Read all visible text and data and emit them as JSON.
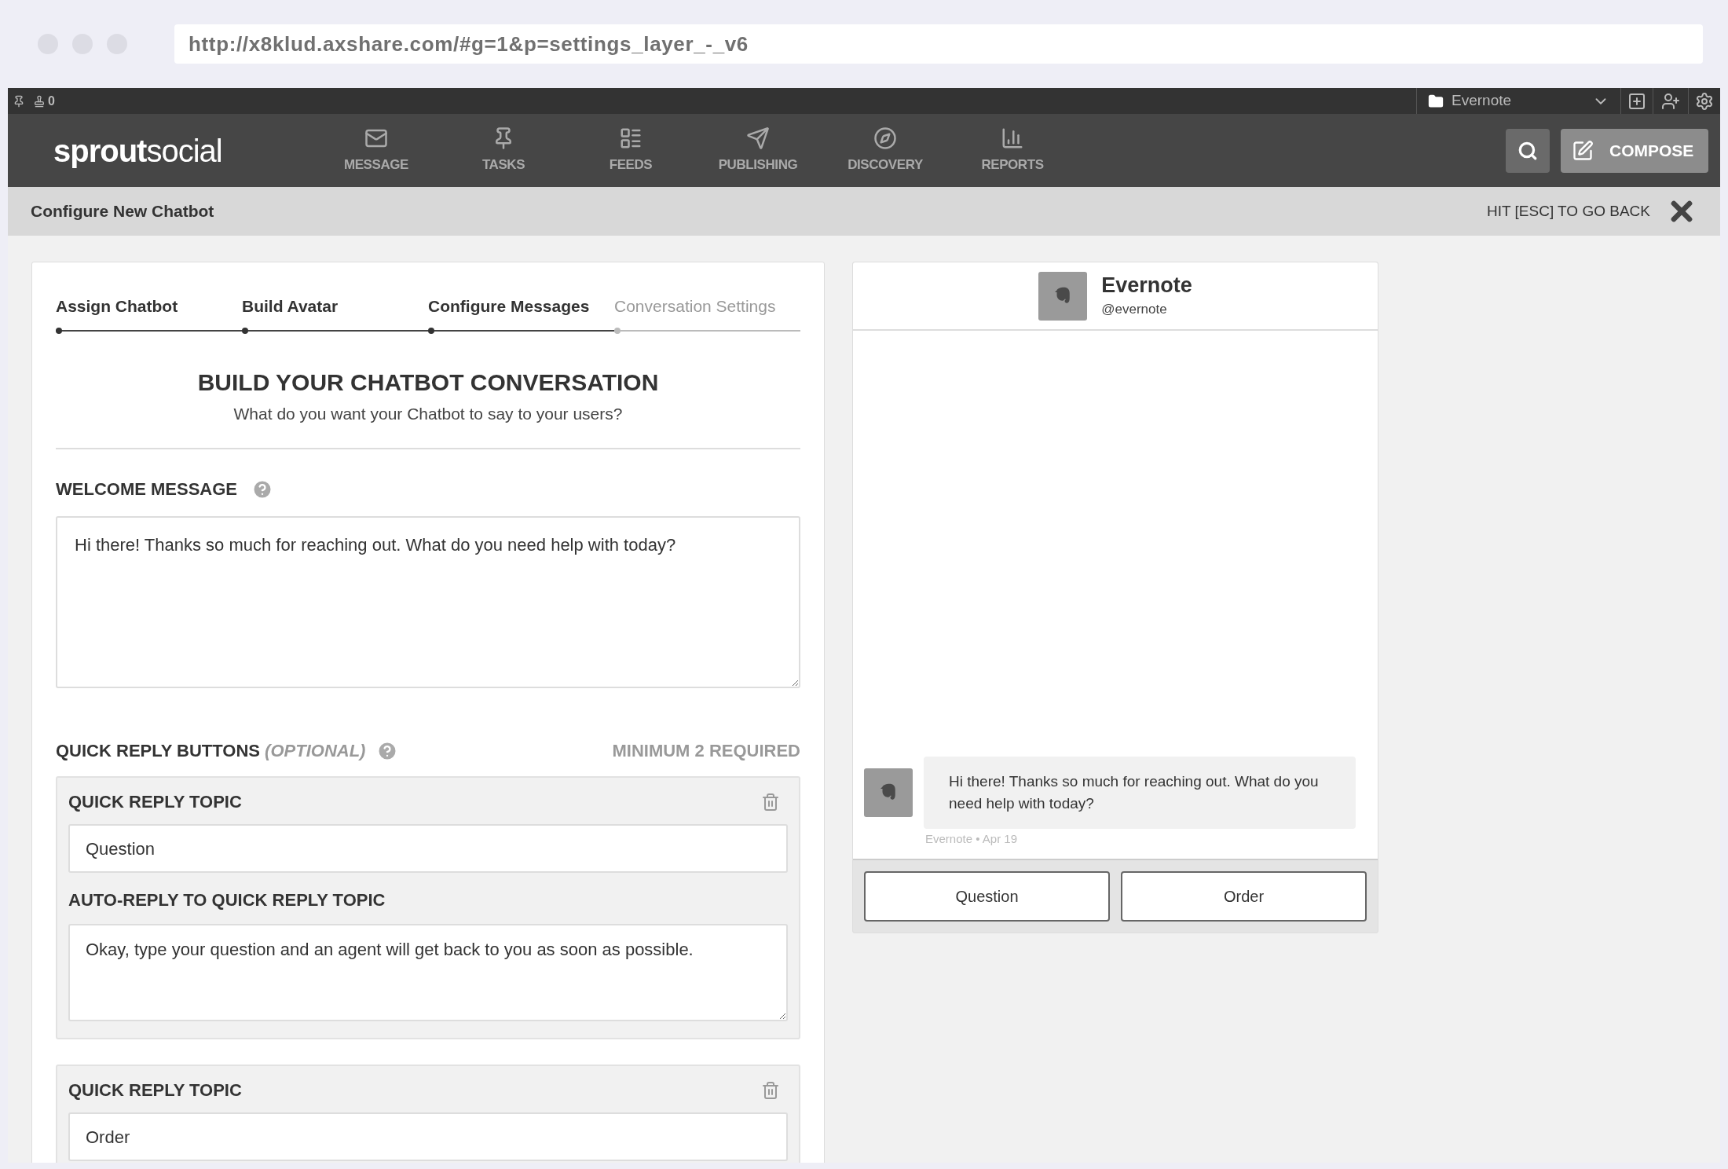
{
  "browser": {
    "url": "http://x8klud.axshare.com/#g=1&p=settings_layer_-_v6"
  },
  "top_bar": {
    "count": "0",
    "account": "Evernote"
  },
  "nav": {
    "logo_bold": "sprout",
    "logo_light": "social",
    "items": [
      {
        "label": "MESSAGE"
      },
      {
        "label": "TASKS"
      },
      {
        "label": "FEEDS"
      },
      {
        "label": "PUBLISHING"
      },
      {
        "label": "DISCOVERY"
      },
      {
        "label": "REPORTS"
      }
    ],
    "compose": "COMPOSE"
  },
  "subheader": {
    "title": "Configure New Chatbot",
    "hint": "HIT [ESC] TO GO BACK"
  },
  "steps": [
    {
      "label": "Assign Chatbot",
      "done": true
    },
    {
      "label": "Build Avatar",
      "done": true
    },
    {
      "label": "Configure Messages",
      "done": true
    },
    {
      "label": "Conversation Settings",
      "done": false
    }
  ],
  "heading": "BUILD YOUR CHATBOT CONVERSATION",
  "subheading": "What do you want your Chatbot to say to your users?",
  "welcome": {
    "label": "WELCOME MESSAGE",
    "value": "Hi there! Thanks so much for reaching out. What do you need help with today?"
  },
  "quick_replies": {
    "label": "QUICK REPLY BUTTONS",
    "optional": "(OPTIONAL)",
    "requirement": "MINIMUM 2 REQUIRED",
    "items": [
      {
        "header": "QUICK REPLY TOPIC",
        "topic": "Question",
        "auto_reply_label": "AUTO-REPLY TO QUICK REPLY TOPIC",
        "auto_reply": "Okay, type your question and an agent will get back to you as soon as possible."
      },
      {
        "header": "QUICK REPLY TOPIC",
        "topic": "Order"
      }
    ]
  },
  "preview": {
    "name": "Evernote",
    "handle": "@evernote",
    "message": "Hi there! Thanks so much for reaching out. What do you need help with today?",
    "meta": "Evernote • Apr 19",
    "buttons": [
      "Question",
      "Order"
    ]
  }
}
